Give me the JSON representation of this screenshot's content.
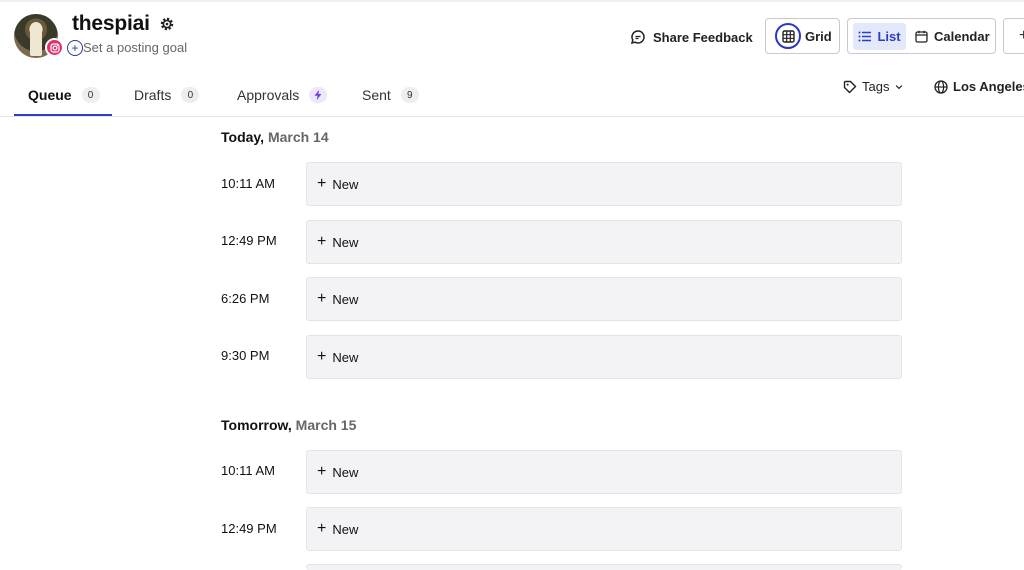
{
  "profile": {
    "name": "thespiai",
    "goal_text": "Set a posting goal"
  },
  "header": {
    "share_feedback": "Share Feedback",
    "grid": "Grid",
    "list": "List",
    "calendar": "Calendar",
    "more": "+"
  },
  "tabs": [
    {
      "label": "Queue",
      "count": "0"
    },
    {
      "label": "Drafts",
      "count": "0"
    },
    {
      "label": "Approvals",
      "count": ""
    },
    {
      "label": "Sent",
      "count": "9"
    }
  ],
  "filters": {
    "tags": "Tags",
    "timezone": "Los Angeles"
  },
  "days": [
    {
      "label": "Today,",
      "date": "March 14",
      "slots": [
        {
          "time": "10:11 AM",
          "action": "New"
        },
        {
          "time": "12:49 PM",
          "action": "New"
        },
        {
          "time": "6:26 PM",
          "action": "New"
        },
        {
          "time": "9:30 PM",
          "action": "New"
        }
      ]
    },
    {
      "label": "Tomorrow,",
      "date": "March 15",
      "slots": [
        {
          "time": "10:11 AM",
          "action": "New"
        },
        {
          "time": "12:49 PM",
          "action": "New"
        }
      ]
    }
  ],
  "colors": {
    "accent": "#2b3fc4",
    "instagram": "#e1306c",
    "approvals_badge": "#ede7fb"
  }
}
